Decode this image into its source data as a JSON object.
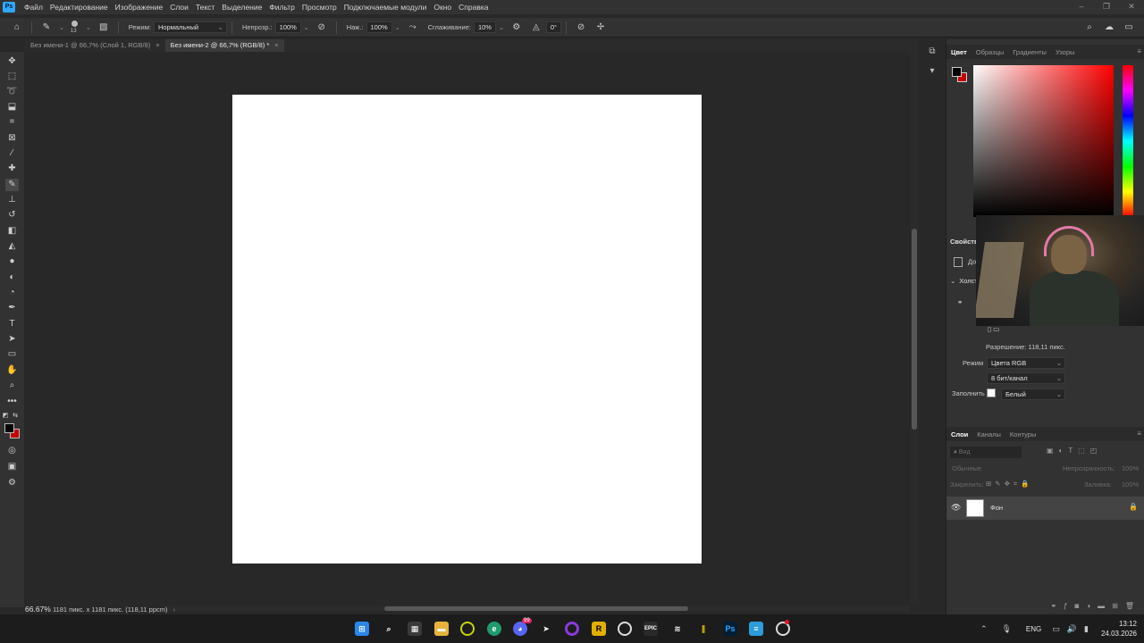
{
  "app": {
    "logo": "Ps",
    "menu": [
      "Файл",
      "Редактирование",
      "Изображение",
      "Слои",
      "Текст",
      "Выделение",
      "Фильтр",
      "Просмотр",
      "Подключаемые модули",
      "Окно",
      "Справка"
    ]
  },
  "options": {
    "brush_size": "13",
    "mode_label": "Режим:",
    "mode_value": "Нормальный",
    "opacity_label": "Непрозр.:",
    "opacity_value": "100%",
    "pressure_label": "Наж.:",
    "pressure_value": "100%",
    "smoothing_label": "Сглаживание:",
    "smoothing_value": "10%",
    "angle_value": "0°"
  },
  "tabs": [
    {
      "label": "Без имени-1 @ 66,7% (Слой 1, RGB/8)",
      "active": false
    },
    {
      "label": "Без имени-2 @ 66,7% (RGB/8) *",
      "active": true
    }
  ],
  "status": {
    "zoom": "66.67%",
    "info": "1181 пикс. x 1181 пикс. (118,11 ppcm)"
  },
  "color_panel": {
    "tabs": [
      "Цвет",
      "Образцы",
      "Градиенты",
      "Узоры"
    ],
    "foreground": "#000000",
    "background": "#c40000"
  },
  "properties": {
    "title": "Свойства",
    "doc_label": "До",
    "canvas_section": "Холст",
    "resolution": "Разрешение: 118,11 пикс.",
    "mode_label": "Режим",
    "mode_value": "Цвета RGB",
    "depth_value": "8 бит/канал",
    "fill_label": "Заполнить",
    "fill_value": "Белый"
  },
  "layers_panel": {
    "tabs": [
      "Слои",
      "Каналы",
      "Контуры"
    ],
    "search_placeholder": "Вид",
    "blend_mode": "Обычные",
    "opacity_label": "Непрозрачность:",
    "opacity_value": "100%",
    "lock_label": "Закрепить:",
    "fill_label": "Заливка:",
    "fill_value": "100%",
    "layer_name": "Фон"
  },
  "taskbar": {
    "badge": "99",
    "lang": "ENG",
    "time": "13:12",
    "date": "24.03.2026"
  }
}
